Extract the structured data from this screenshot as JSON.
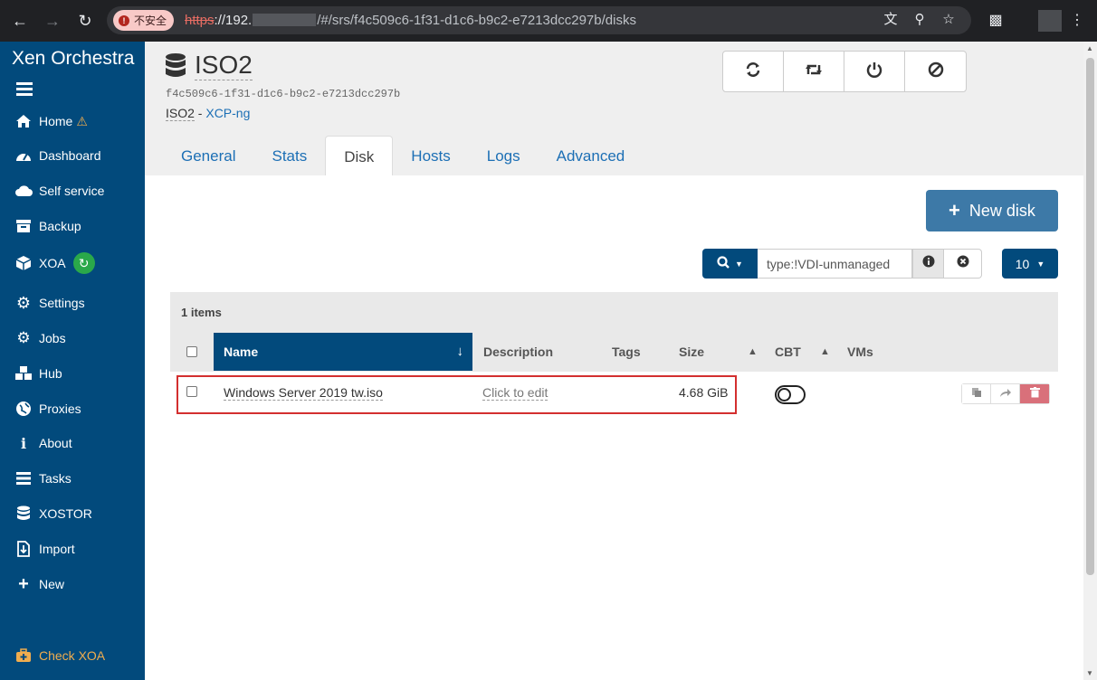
{
  "browser": {
    "insecure_label": "不安全",
    "url_proto": "https",
    "url_host": "://192.",
    "url_path": "/#/srs/f4c509c6-1f31-d1c6-b9c2-e7213dcc297b/disks"
  },
  "sidebar": {
    "brand": "Xen Orchestra",
    "items": [
      {
        "label": "Home",
        "icon": "home-icon"
      },
      {
        "label": "Dashboard",
        "icon": "dashboard-icon"
      },
      {
        "label": "Self service",
        "icon": "cloud-icon"
      },
      {
        "label": "Backup",
        "icon": "archive-icon"
      },
      {
        "label": "XOA",
        "icon": "cube-icon"
      },
      {
        "label": "Settings",
        "icon": "cog-icon"
      },
      {
        "label": "Jobs",
        "icon": "cogs-icon"
      },
      {
        "label": "Hub",
        "icon": "cubes-icon"
      },
      {
        "label": "Proxies",
        "icon": "globe-icon"
      },
      {
        "label": "About",
        "icon": "info-icon"
      },
      {
        "label": "Tasks",
        "icon": "tasks-icon"
      },
      {
        "label": "XOSTOR",
        "icon": "database-icon"
      },
      {
        "label": "Import",
        "icon": "file-import-icon"
      },
      {
        "label": "New",
        "icon": "plus-icon"
      }
    ],
    "check_xoa": "Check XOA"
  },
  "header": {
    "title": "ISO2",
    "uuid": "f4c509c6-1f31-d1c6-b9c2-e7213dcc297b",
    "sr_name": "ISO2",
    "separator": " - ",
    "pool_name": "XCP-ng"
  },
  "tabs": [
    "General",
    "Stats",
    "Disk",
    "Hosts",
    "Logs",
    "Advanced"
  ],
  "toolbar": {
    "new_disk": "New disk",
    "filter_value": "type:!VDI-unmanaged",
    "page_size": "10"
  },
  "table": {
    "items_count": "1 items",
    "columns": [
      "Name",
      "Description",
      "Tags",
      "Size",
      "CBT",
      "VMs"
    ],
    "rows": [
      {
        "name": "Windows Server 2019 tw.iso",
        "description": "Click to edit",
        "size": "4.68 GiB",
        "cbt": false
      }
    ]
  },
  "colors": {
    "sidebar_bg": "#024a7c",
    "accent": "#1c6fb5",
    "new_disk_bg": "#3d79a7",
    "delete_bg": "#d9707a",
    "highlight_border": "#d32f2f"
  }
}
